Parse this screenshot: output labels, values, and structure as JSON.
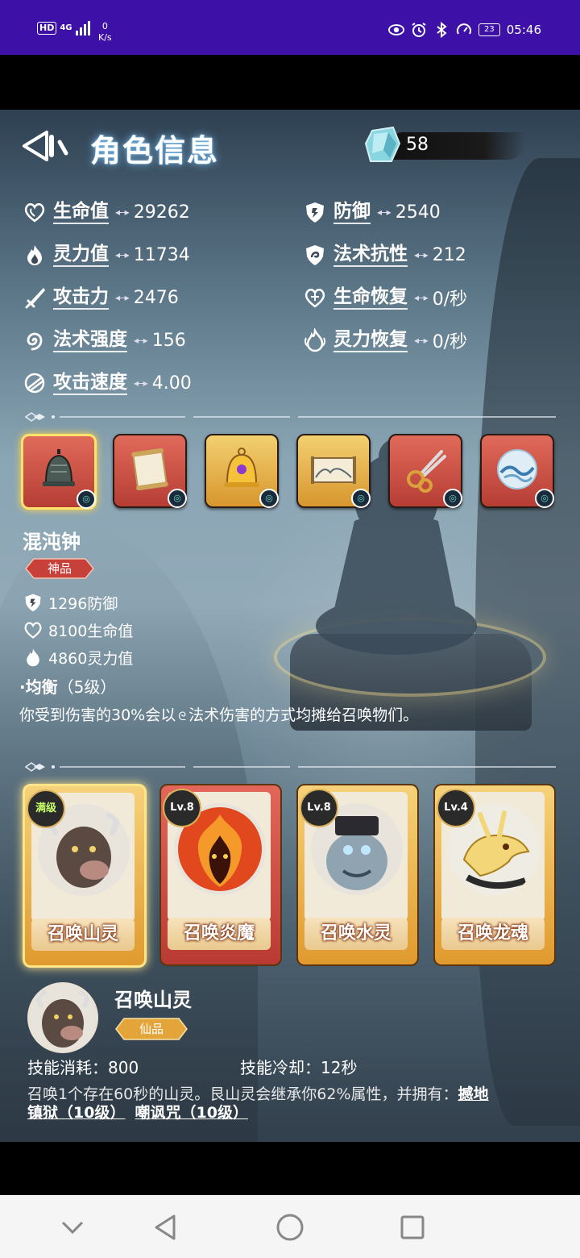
{
  "status_bar": {
    "hd": "HD",
    "network": "4G",
    "speed_value": "0",
    "speed_unit": "K/s",
    "battery": "23",
    "time": "05:46"
  },
  "header": {
    "title": "角色信息",
    "currency_value": "58"
  },
  "stats": [
    {
      "icon": "heart-icon",
      "label": "生命值",
      "value": "29262"
    },
    {
      "icon": "shield-icon",
      "label": "防御",
      "value": "2540"
    },
    {
      "icon": "flame-icon",
      "label": "灵力值",
      "value": "11734"
    },
    {
      "icon": "spell-shield-icon",
      "label": "法术抗性",
      "value": "212"
    },
    {
      "icon": "sword-icon",
      "label": "攻击力",
      "value": "2476"
    },
    {
      "icon": "heart-regen-icon",
      "label": "生命恢复",
      "value": "0/秒"
    },
    {
      "icon": "spiral-icon",
      "label": "法术强度",
      "value": "156"
    },
    {
      "icon": "flame-regen-icon",
      "label": "灵力恢复",
      "value": "0/秒"
    },
    {
      "icon": "speed-icon",
      "label": "攻击速度",
      "value": "4.00"
    }
  ],
  "items": [
    {
      "name": "bell-item",
      "art": "bell"
    },
    {
      "name": "scroll-item",
      "art": "scroll"
    },
    {
      "name": "golden-bell-item",
      "art": "golden-bell"
    },
    {
      "name": "painting-item",
      "art": "painting"
    },
    {
      "name": "scissors-item",
      "art": "scissors"
    },
    {
      "name": "water-orb-item",
      "art": "orb"
    }
  ],
  "selected_item": {
    "name": "混沌钟",
    "grade": "神品",
    "stats": [
      {
        "icon": "shield-icon",
        "text": "1296防御"
      },
      {
        "icon": "heart-icon",
        "text": "8100生命值"
      },
      {
        "icon": "flame-icon",
        "text": "4860灵力值"
      }
    ],
    "passive_name": "·均衡",
    "passive_level": "（5级）",
    "passive_desc_a": "你受到伤害的30%会以",
    "passive_desc_b": "法术伤害的方式均摊给召唤物们。"
  },
  "summons": [
    {
      "level": "满级",
      "name": "召唤山灵",
      "style": "gold",
      "selected": true
    },
    {
      "level": "Lv.8",
      "name": "召唤炎魔",
      "style": "red",
      "selected": false
    },
    {
      "level": "Lv.8",
      "name": "召唤水灵",
      "style": "gold",
      "selected": false
    },
    {
      "level": "Lv.4",
      "name": "召唤龙魂",
      "style": "gold",
      "selected": false
    }
  ],
  "summon_detail": {
    "name": "召唤山灵",
    "grade": "仙品",
    "cost": "技能消耗：800",
    "cooldown": "技能冷却：12秒",
    "desc": "召唤1个存在60秒的山灵。艮山灵会继承你62%属性，并拥有：",
    "skill1": "撼地",
    "skill1b": "镇狱（10级）",
    "skill2": "嘲讽咒（10级）"
  },
  "colors": {
    "status_bar": "#3d11a8",
    "title_glow": "#8fd2ff",
    "item_red": "#c84a3f",
    "item_gold": "#e4b04a",
    "selected_glow": "#ffe36a"
  }
}
